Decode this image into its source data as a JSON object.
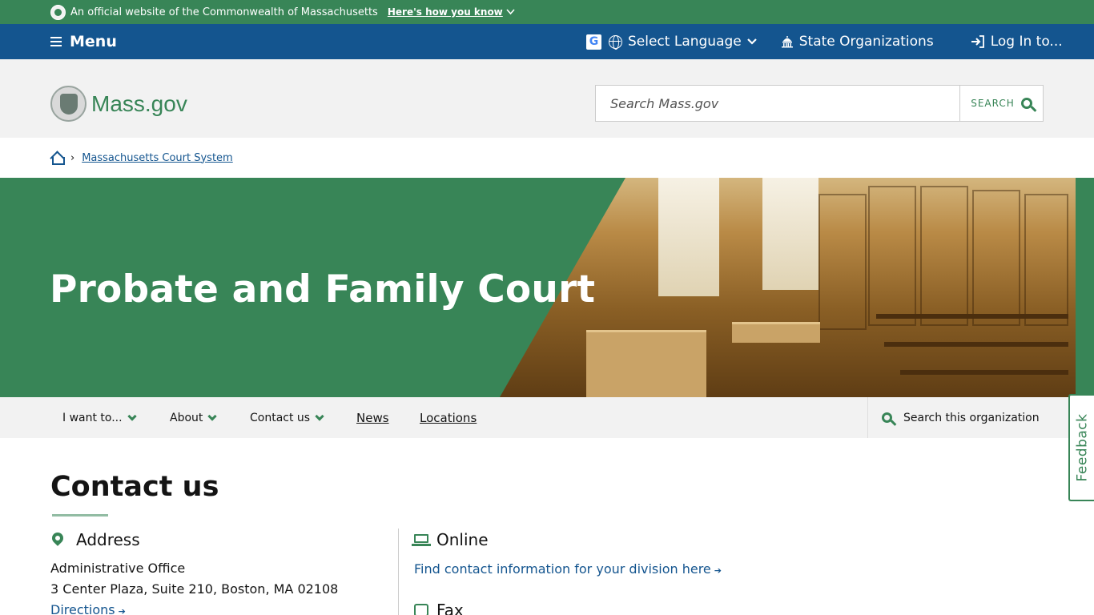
{
  "official_bar": {
    "text": "An official website of the Commonwealth of Massachusetts",
    "how_link": "Here's how you know"
  },
  "util_nav": {
    "menu_label": "Menu",
    "language_label": "Select Language",
    "orgs_label": "State Organizations",
    "login_label": "Log In to..."
  },
  "header": {
    "logo_text": "Mass.gov",
    "search_placeholder": "Search Mass.gov",
    "search_button": "SEARCH"
  },
  "breadcrumb": {
    "link": "Massachusetts Court System"
  },
  "hero": {
    "title": "Probate and Family Court"
  },
  "org_nav": {
    "items": [
      {
        "label": "I want to..."
      },
      {
        "label": "About"
      },
      {
        "label": "Contact us"
      }
    ],
    "links": [
      {
        "label": "News"
      },
      {
        "label": "Locations"
      }
    ],
    "search_label": "Search this organization"
  },
  "feedback": {
    "label": "Feedback"
  },
  "contact": {
    "title": "Contact us",
    "address": {
      "heading": "Address",
      "line1": "Administrative Office",
      "line2": "3 Center Plaza, Suite 210, Boston, MA 02108",
      "directions": "Directions"
    },
    "online": {
      "heading": "Online",
      "link": "Find contact information for your division here"
    },
    "fax": {
      "heading": "Fax"
    }
  },
  "colors": {
    "green": "#388557",
    "blue": "#14558f",
    "light_gray": "#f2f2f2"
  },
  "icons": [
    "seal-icon",
    "hamburger-icon",
    "google-translate-icon",
    "globe-icon",
    "chevron-down-icon",
    "capitol-icon",
    "login-icon",
    "search-icon",
    "home-icon",
    "map-pin-icon",
    "laptop-icon",
    "fax-icon",
    "arrow-right-icon"
  ]
}
